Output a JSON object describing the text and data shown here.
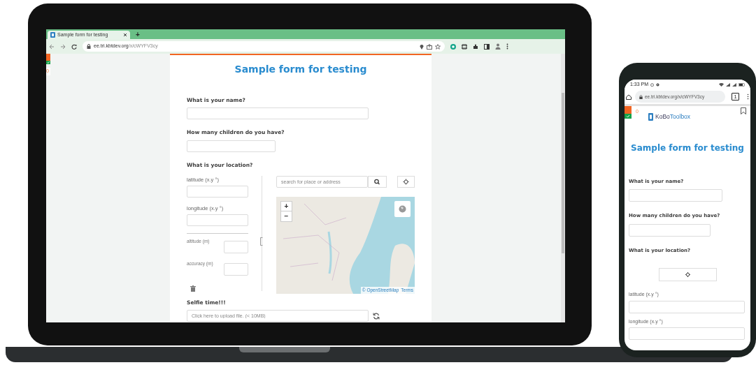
{
  "laptop": {
    "browser": {
      "tab_title": "Sample form for testing",
      "new_tab": "+",
      "url_host": "ee.tri.kbtdev.org",
      "url_path": "/x/cWYFV3cy"
    },
    "badge_count": "0",
    "form": {
      "title": "Sample form for testing",
      "questions": [
        {
          "kind": "text",
          "label": "What is your name?"
        },
        {
          "kind": "number",
          "label": "How many children do you have?"
        },
        {
          "kind": "location",
          "label": "What is your location?",
          "latitude": "latitude (x.y °)",
          "longitude": "longitude (x.y °)",
          "altitude": "altitude (m)",
          "accuracy": "accuracy (m)",
          "search_placeholder": "search for place or address",
          "zoom_in": "+",
          "zoom_out": "−",
          "attribution": "© OpenStreetMap",
          "terms": "Terms"
        },
        {
          "kind": "file",
          "label": "Selfie time!!!",
          "placeholder": "Click here to upload file. (< 10MB)"
        }
      ]
    }
  },
  "phone": {
    "status_time": "1:33 PM",
    "url": "ee.tri.kbtdev.org/x/cWYFV3cy",
    "tab_count": "1",
    "badge_count": "0",
    "logo": {
      "part_1": "KoBo",
      "part_2": "Toolbox"
    },
    "form": {
      "title": "Sample form for testing",
      "questions": [
        {
          "kind": "text",
          "label": "What is your name?"
        },
        {
          "kind": "number",
          "label": "How many children do you have?"
        },
        {
          "kind": "location",
          "label": "What is your location?",
          "latitude": "latitude (x.y °)",
          "longitude": "longitude (x.y °)"
        }
      ]
    }
  }
}
